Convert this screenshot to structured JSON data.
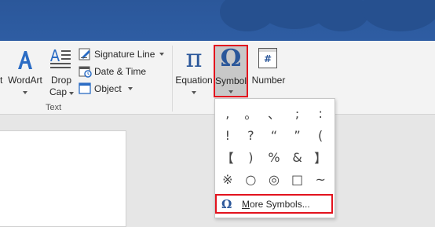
{
  "ribbon": {
    "wordart_label": "WordArt",
    "dropcap_label_1": "Drop",
    "dropcap_label_2": "Cap",
    "signature_label": "Signature Line",
    "datetime_label": "Date & Time",
    "object_label": "Object",
    "group_text": "Text",
    "equation_label": "Equation",
    "symbol_label": "Symbol",
    "number_label": "Number",
    "pi_glyph": "π",
    "omega_glyph": "Ω",
    "number_glyph": "#",
    "left_cut_label": "t"
  },
  "symbols": {
    "grid": [
      ",",
      "。",
      "、",
      ";",
      ":",
      "!",
      "?",
      "“",
      "”",
      "(",
      "【",
      ")",
      "%",
      "&",
      "】",
      "※",
      "○",
      "◎",
      "□",
      "~"
    ],
    "more_omega": "Ω",
    "more_label": "More Symbols...",
    "more_underline_char": "M",
    "more_rest": "ore Symbols..."
  },
  "colors": {
    "accent": "#2b579a",
    "highlight": "#e3131e"
  }
}
